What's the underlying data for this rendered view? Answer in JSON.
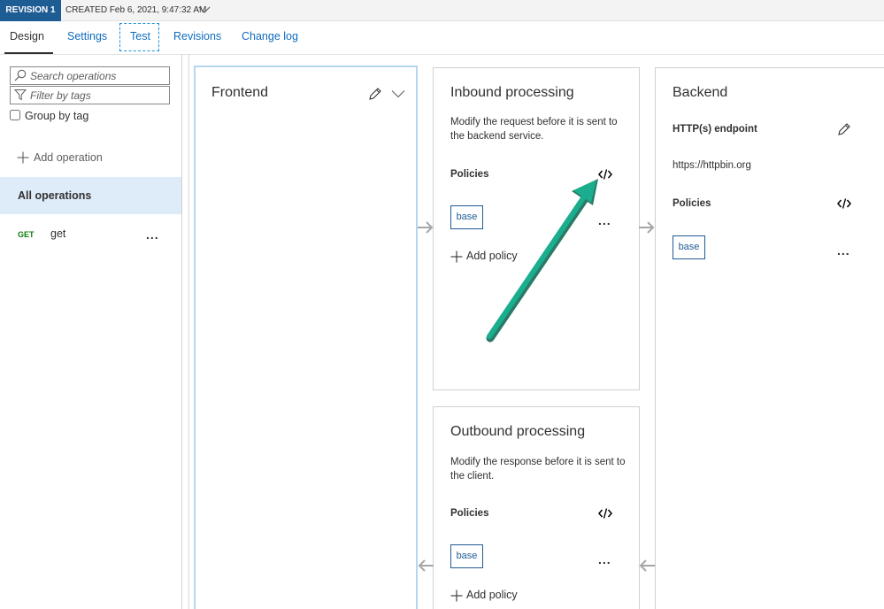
{
  "revision": {
    "badge": "REVISION 1",
    "created": "CREATED Feb 6, 2021, 9:47:32 AM"
  },
  "tabs": [
    {
      "label": "Design"
    },
    {
      "label": "Settings"
    },
    {
      "label": "Test"
    },
    {
      "label": "Revisions"
    },
    {
      "label": "Change log"
    }
  ],
  "sidebar": {
    "search_placeholder": "Search operations",
    "filter_placeholder": "Filter by tags",
    "group_by_label": "Group by tag",
    "add_operation": "Add operation",
    "all_operations": "All operations",
    "operations": [
      {
        "method": "GET",
        "name": "get",
        "more": "..."
      }
    ]
  },
  "frontend": {
    "title": "Frontend"
  },
  "inbound": {
    "title": "Inbound processing",
    "description": "Modify the request before it is sent to the backend service.",
    "policies_label": "Policies",
    "policy_tag": "base",
    "more": "...",
    "add_policy": "Add policy"
  },
  "outbound": {
    "title": "Outbound processing",
    "description": "Modify the response before it is sent to the client.",
    "policies_label": "Policies",
    "policy_tag": "base",
    "more": "...",
    "add_policy": "Add policy"
  },
  "backend": {
    "title": "Backend",
    "endpoint_label": "HTTP(s) endpoint",
    "endpoint_url": "https://httpbin.org",
    "policies_label": "Policies",
    "policy_tag": "base",
    "more": "..."
  },
  "colors": {
    "accent": "#0f6cbd",
    "revision_badge": "#1e5c94",
    "selected_row": "#deecf9",
    "get_method": "#107c10",
    "annotation_arrow": "#1aae8e"
  }
}
